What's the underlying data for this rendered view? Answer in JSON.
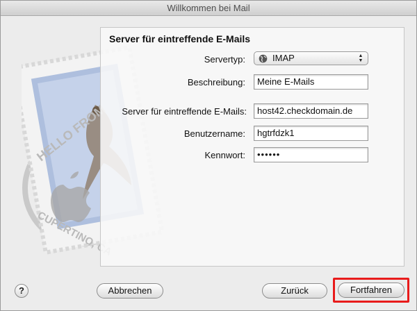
{
  "window": {
    "title": "Willkommen bei Mail"
  },
  "panel": {
    "title": "Server für eintreffende E-Mails",
    "servertyp": {
      "label": "Servertyp:",
      "value": "IMAP",
      "icon": "globe-icon"
    },
    "beschreibung": {
      "label": "Beschreibung:",
      "value": "Meine E-Mails"
    },
    "server": {
      "label": "Server für eintreffende E-Mails:",
      "value": "host42.checkdomain.de"
    },
    "benutzername": {
      "label": "Benutzername:",
      "value": "hgtrfdzk1"
    },
    "kennwort": {
      "label": "Kennwort:",
      "value": "••••••"
    }
  },
  "stamp": {
    "text_top": "HELLO FROM",
    "text_bottom": "CUPERTINO, CA"
  },
  "buttons": {
    "help": "?",
    "cancel": "Abbrechen",
    "back": "Zurück",
    "continue": "Fortfahren"
  },
  "colors": {
    "highlight": "#e81b1b",
    "stamp_blue": "#9fb3d6"
  }
}
